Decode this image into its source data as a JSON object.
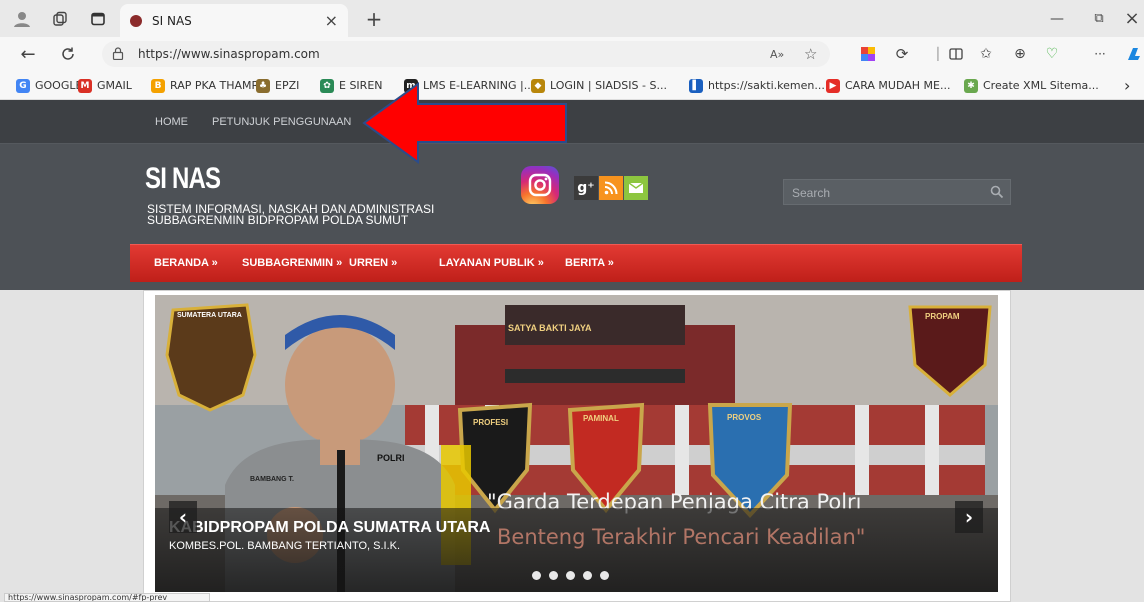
{
  "browser": {
    "tab_title": "SI NAS",
    "tab_close": "×",
    "new_tab": "+",
    "url": "https://www.sinaspropam.com",
    "read_aloud": "A»",
    "more": "···",
    "win_min": "—",
    "win_restore": "⧉",
    "win_close": "×"
  },
  "bookmarks": [
    {
      "label": "GOOGLE",
      "icon": "G",
      "color": "#4285f4"
    },
    {
      "label": "GMAIL",
      "icon": "M",
      "color": "#d93025"
    },
    {
      "label": "RAP PKA THAMRIN",
      "icon": "B",
      "color": "#f4a100"
    },
    {
      "label": "EPZI",
      "icon": "♣",
      "color": "#8a6d2f"
    },
    {
      "label": "E SIREN",
      "icon": "✿",
      "color": "#2a8a56"
    },
    {
      "label": "LMS E-LEARNING |...",
      "icon": "m",
      "color": "#222222"
    },
    {
      "label": "LOGIN | SIADSIS - S...",
      "icon": "◆",
      "color": "#b8860b"
    },
    {
      "label": "https://sakti.kemen...",
      "icon": "▌",
      "color": "#1a5fbf"
    },
    {
      "label": "CARA MUDAH ME...",
      "icon": "▶",
      "color": "#e52d27"
    },
    {
      "label": "Create XML Sitema...",
      "icon": "✱",
      "color": "#6aa84f"
    }
  ],
  "bookmarks_more": "›",
  "site": {
    "topnav": [
      "HOME",
      "PETUNJUK PENGGUNAAN"
    ],
    "logo": "SI NAS",
    "tagline_1": "SISTEM INFORMASI, NASKAH DAN ADMINISTRASI",
    "tagline_2": "SUBBAGRENMIN BIDPROPAM POLDA SUMUT",
    "search_placeholder": "Search",
    "menu": [
      "BERANDA »",
      "SUBBAGRENMIN »",
      "URREN »",
      "LAYANAN PUBLIK »",
      "BERITA »"
    ],
    "slide": {
      "banner_top": "SATYA BAKTI JAYA",
      "badge_left": "SUMATERA UTARA",
      "badge_right": "PROPAM",
      "shield_1": "PROFESI",
      "shield_2": "PAMINAL",
      "shield_3": "PROVOS",
      "nametag": "BAMBANG T.",
      "polri": "POLRI",
      "slogan_1": "\"Garda Terdepan Penjaga Citra Polri",
      "slogan_2": "Benteng Terakhir Pencari Keadilan\"",
      "caption_title": "KABIDPROPAM POLDA SUMATRA UTARA",
      "caption_sub": "KOMBES.POL. BAMBANG TERTIANTO, S.I.K.",
      "prev": "‹",
      "next": "›",
      "dots": 5
    }
  },
  "status_url": "https://www.sinaspropam.com/#fp-prev",
  "colors": {
    "menu_red": "#d4302a",
    "header_dark": "#4d5156",
    "arrow_red": "#ff0000"
  }
}
